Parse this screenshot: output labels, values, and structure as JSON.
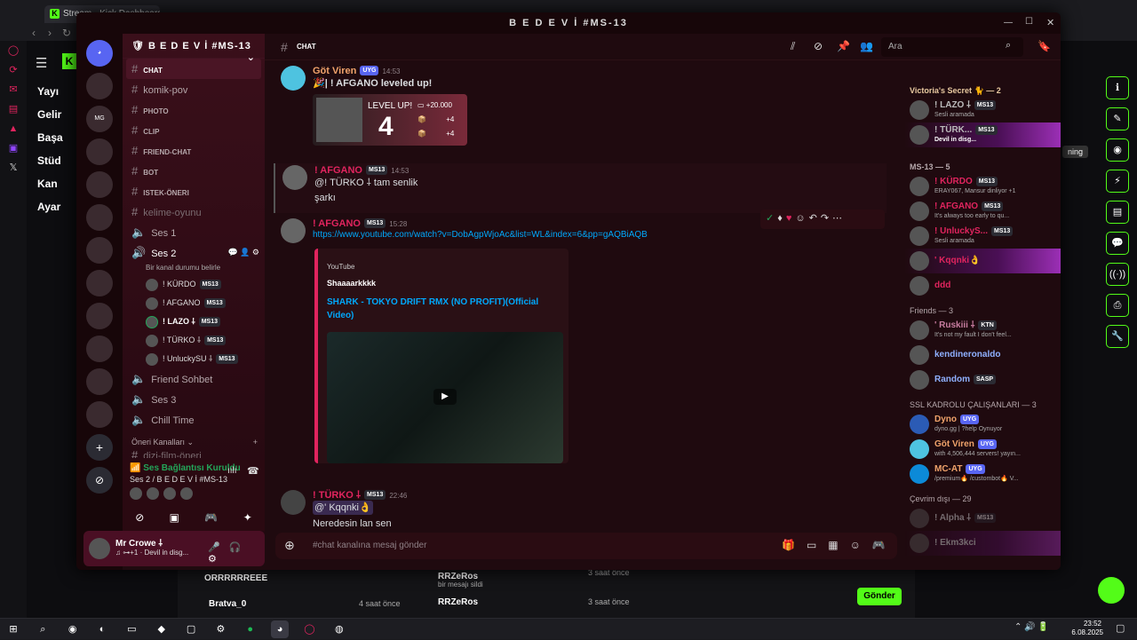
{
  "browser": {
    "tab_title": "Stream - Kick Dashboard",
    "time": "23:52",
    "date": "6.08.2025"
  },
  "kick": {
    "nav": [
      "Yayı",
      "Gelir",
      "Başa",
      "Stüd",
      "Kan",
      "Ayar"
    ],
    "live_badge": "ning",
    "bottom": {
      "r1_user": "ORRRRRREEE",
      "r2_user": "Bratva_0",
      "r2_time": "4 saat önce",
      "c1_user": "RRZeRos",
      "c1_text": "bir mesajı sildi",
      "c1_time": "3 saat önce",
      "c2_user": "RRZeRos",
      "c2_time": "3 saat önce",
      "send_btn": "Gönder"
    }
  },
  "discord": {
    "window_title": "B E D E V İ #MS-13",
    "server_name": "B E D E V İ #MS-13",
    "channels": [
      {
        "name": "chat",
        "type": "text"
      },
      {
        "name": "komik-pov",
        "type": "text"
      },
      {
        "name": "photo",
        "type": "text"
      },
      {
        "name": "clip",
        "type": "text"
      },
      {
        "name": "friend-chat",
        "type": "text"
      },
      {
        "name": "bot",
        "type": "text"
      },
      {
        "name": "istek-öneri",
        "type": "text"
      },
      {
        "name": "kelime-oyunu",
        "type": "text"
      },
      {
        "name": "Ses 1",
        "type": "voice"
      },
      {
        "name": "Ses 2",
        "type": "voice"
      }
    ],
    "voice_status": "Bir kanal durumu belirle",
    "voice_members": [
      {
        "name": "! KÜRDO",
        "tag": "MS13"
      },
      {
        "name": "! AFGANO",
        "tag": "MS13"
      },
      {
        "name": "! LAZO ⸸",
        "tag": "MS13"
      },
      {
        "name": "! TÜRKO ⸸",
        "tag": "MS13"
      },
      {
        "name": "! UnluckySU ⸸",
        "tag": "MS13"
      }
    ],
    "more_channels": [
      "Friend Sohbet",
      "Ses 3",
      "Chill Time"
    ],
    "category": "Öneri Kanalları",
    "cut_channel": "dizi-film-öneri",
    "voice_connected": "Ses Bağlantısı Kuruldu",
    "voice_location": "Ses 2 / B E D E V İ #MS-13",
    "user": {
      "name": "Mr Crowe ⸸",
      "status": "Devil in disg..."
    },
    "chat": {
      "channel": "chat",
      "search_placeholder": "Ara",
      "input_placeholder": "#chat kanalına mesaj gönder",
      "messages": {
        "m1_user": "Göt Viren",
        "m1_tag": "UYG",
        "m1_time": "14:53",
        "m1_text": "| ! AFGANO leveled up!",
        "level_text": "LEVEL UP!",
        "level_number": "4",
        "level_xp": "+20.000",
        "level_plus1": "+4",
        "level_plus2": "+4",
        "m2_user": "! AFGANO",
        "m2_tag": "MS13",
        "m2_time": "14:53",
        "m2_text1": "@! TÜRKO ⸸ tam senlik",
        "m2_text2": "şarkı",
        "m3_user": "! AFGANO",
        "m3_tag": "MS13",
        "m3_time": "15:28",
        "m3_link": "https://www.youtube.com/watch?v=DobAgpWjoAc&list=WL&index=6&pp=gAQBiAQB",
        "embed_provider": "YouTube",
        "embed_author": "Shaaaarkkkk",
        "embed_title": "SHARK - TOKYO DRIFT RMX (NO PROFIT)(Official Video)",
        "m4_user": "! TÜRKO ⸸",
        "m4_tag": "MS13",
        "m4_time": "22:46",
        "m4_text1": "@' Kqqnki👌",
        "m4_text2": "Neredesin lan sen"
      }
    },
    "members": {
      "g1_title": "Victoria's Secret 🐈 — 2",
      "g1": [
        {
          "name": "! LAZO ⸸",
          "tag": "MS13",
          "status": "Sesli aramada"
        },
        {
          "name": "! TÜRK...",
          "tag": "MS13",
          "status": "Devil in disg..."
        }
      ],
      "g2_title": "MS-13 — 5",
      "g2": [
        {
          "name": "! KÜRDO",
          "tag": "MS13",
          "status": "ERAY067, Mansur dinliyor +1"
        },
        {
          "name": "! AFGANO",
          "tag": "MS13",
          "status": "It's always too early to qu..."
        },
        {
          "name": "! UnluckyS...",
          "tag": "MS13",
          "status": "Sesli aramada"
        },
        {
          "name": "' Kqqnki👌",
          "tag": "",
          "status": ""
        },
        {
          "name": "ddd",
          "tag": "",
          "status": ""
        }
      ],
      "g3_title": "Friends — 3",
      "g3": [
        {
          "name": "' Ruskiii ⸸",
          "tag": "KTN",
          "status": "It's not my fault I don't feel..."
        },
        {
          "name": "kendineronaldo",
          "tag": "",
          "status": ""
        },
        {
          "name": "Random",
          "tag": "SASP",
          "status": ""
        }
      ],
      "g4_title": "SSL KADROLU ÇALIŞANLARI — 3",
      "g4": [
        {
          "name": "Dyno",
          "tag": "UYG",
          "status": "dyno.gg | ?help Oynuyor"
        },
        {
          "name": "Göt Viren",
          "tag": "UYG",
          "status": "with 4,506,444 servers! yayın..."
        },
        {
          "name": "MC-AT",
          "tag": "UYG",
          "status": "/premium🔥 /custombot🔥 V..."
        }
      ],
      "g5_title": "Çevrim dışı — 29",
      "g5": [
        {
          "name": "! Alpha ⸸",
          "tag": "MS13"
        },
        {
          "name": "! Ekm3kci",
          "tag": ""
        }
      ]
    }
  }
}
